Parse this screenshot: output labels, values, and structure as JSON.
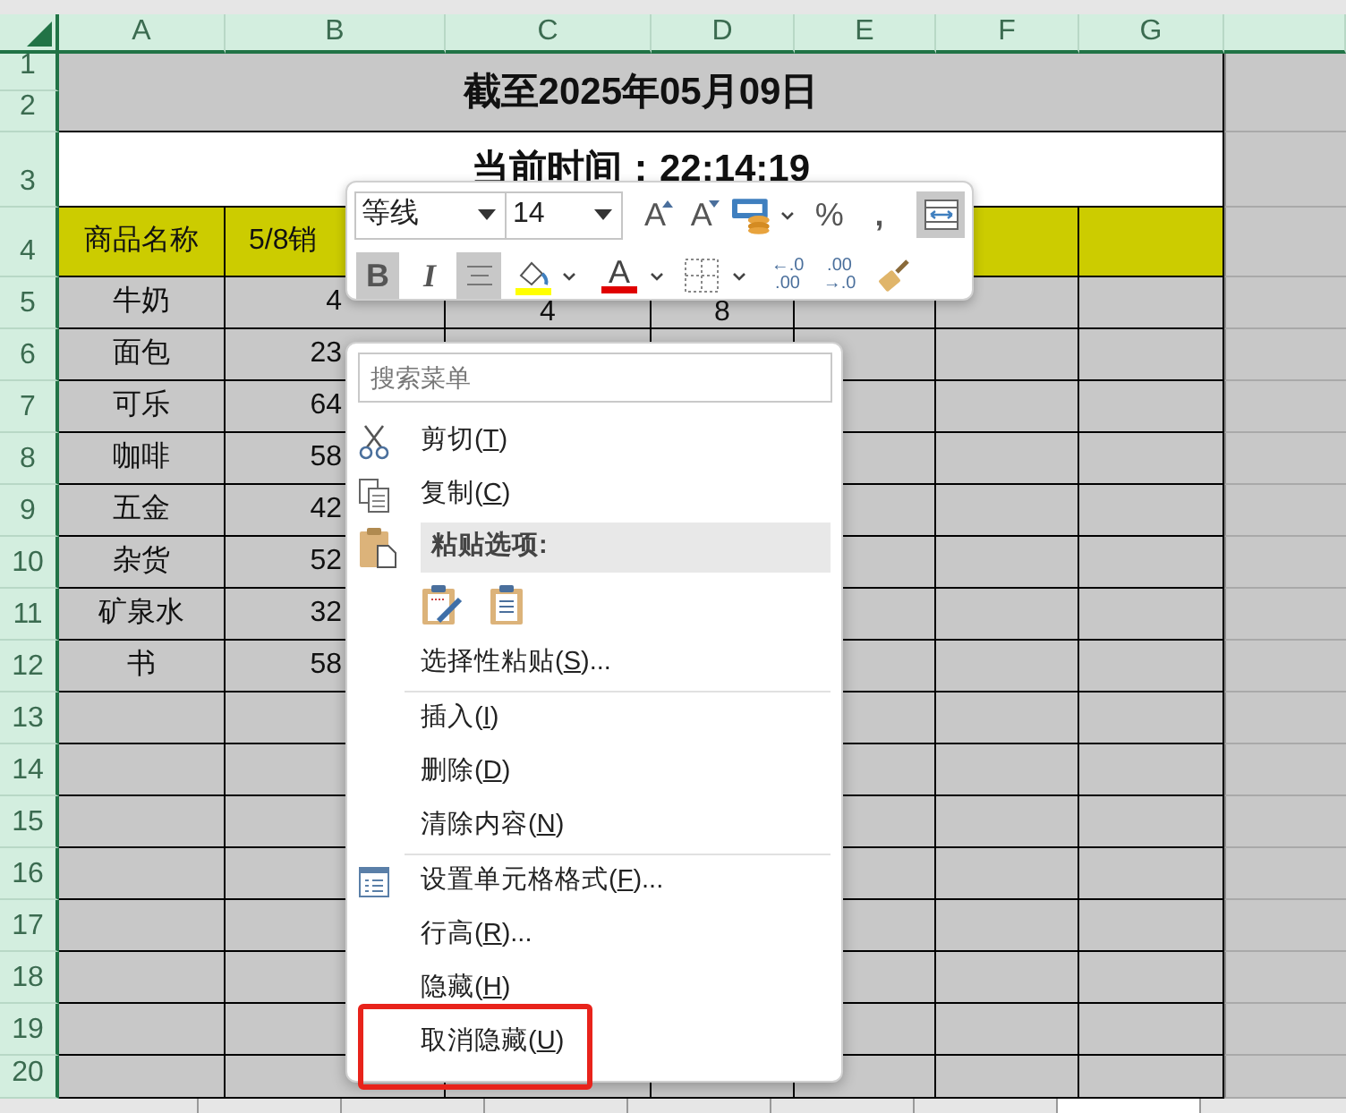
{
  "sheet": {
    "column_headers": [
      "A",
      "B",
      "C",
      "D",
      "E",
      "F",
      "G"
    ],
    "row_headers": [
      "1",
      "2",
      "3",
      "4",
      "5",
      "6",
      "7",
      "8",
      "9",
      "10",
      "11",
      "12",
      "13",
      "14",
      "15",
      "16",
      "17",
      "18",
      "19",
      "20"
    ],
    "title": "截至2025年05月09日",
    "time": "当前时间：22:14:19",
    "header_row": [
      "商品名称",
      "5/8销"
    ],
    "rows": [
      [
        "牛奶",
        "4",
        "4",
        "8"
      ],
      [
        "面包",
        "23"
      ],
      [
        "可乐",
        "64"
      ],
      [
        "咖啡",
        "58"
      ],
      [
        "五金",
        "42"
      ],
      [
        "杂货",
        "52"
      ],
      [
        "矿泉水",
        "32"
      ],
      [
        "书",
        "58"
      ]
    ]
  },
  "mini_toolbar": {
    "font": "等线",
    "size": "14",
    "grow_font": "A",
    "shrink_font": "A",
    "percent": "%",
    "comma": ",",
    "wrap_text_selected": true,
    "bold": {
      "label": "B",
      "selected": true
    },
    "italic": {
      "label": "I",
      "selected": false
    },
    "align_center_selected": true,
    "font_color": "A",
    "increase_decimal": [
      "←.0",
      ".00"
    ],
    "decrease_decimal": [
      ".00",
      "→.0"
    ]
  },
  "context_menu": {
    "search_placeholder": "搜索菜单",
    "items": [
      {
        "kind": "command",
        "before": "剪切(",
        "hotkey": "T",
        "after": ")"
      },
      {
        "kind": "command",
        "before": "复制(",
        "hotkey": "C",
        "after": ")"
      },
      {
        "kind": "header",
        "text": "粘贴选项:"
      },
      {
        "kind": "paste_options"
      },
      {
        "kind": "command",
        "before": "选择性粘贴(",
        "hotkey": "S",
        "after": ")..."
      },
      {
        "kind": "separator"
      },
      {
        "kind": "command",
        "before": "插入(",
        "hotkey": "I",
        "after": ")"
      },
      {
        "kind": "command",
        "before": "删除(",
        "hotkey": "D",
        "after": ")"
      },
      {
        "kind": "command",
        "before": "清除内容(",
        "hotkey": "N",
        "after": ")"
      },
      {
        "kind": "separator"
      },
      {
        "kind": "command",
        "before": "设置单元格格式(",
        "hotkey": "F",
        "after": ")..."
      },
      {
        "kind": "command",
        "before": "行高(",
        "hotkey": "R",
        "after": ")..."
      },
      {
        "kind": "command",
        "before": "隐藏(",
        "hotkey": "H",
        "after": ")"
      },
      {
        "kind": "command",
        "before": "取消隐藏(",
        "hotkey": "U",
        "after": ")",
        "highlighted": true
      }
    ]
  },
  "sheet_tabs": [
    {
      "selected": false
    },
    {
      "selected": false
    },
    {
      "selected": false
    },
    {
      "selected": false
    },
    {
      "selected": false
    },
    {
      "selected": false
    },
    {
      "selected": true
    },
    {
      "selected": false
    }
  ]
}
